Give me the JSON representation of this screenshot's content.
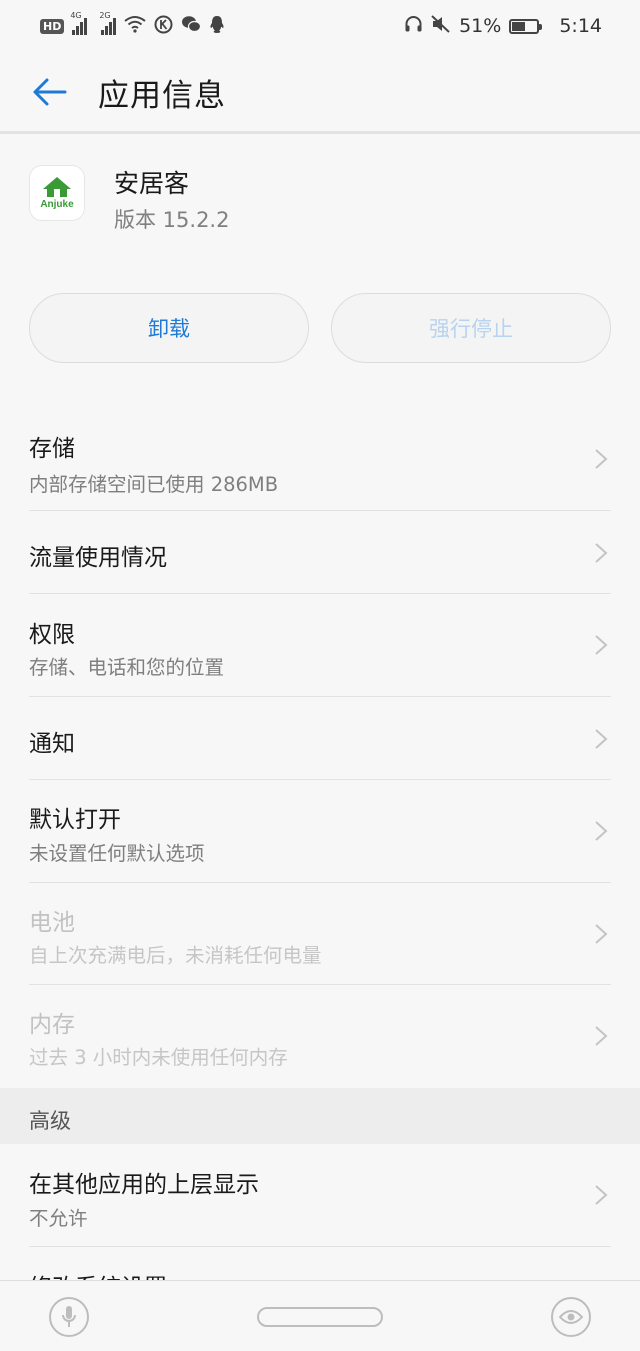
{
  "status_bar": {
    "hd": "HD",
    "sim1_tag": "4G",
    "sim2_tag": "2G",
    "battery_percent": "51%",
    "battery_level": 0.51,
    "time": "5:14"
  },
  "header": {
    "title": "应用信息"
  },
  "app": {
    "name": "安居客",
    "version": "版本 15.2.2",
    "icon_text": "Anjuke",
    "icon_color": "#3a9a35"
  },
  "actions": {
    "uninstall_label": "卸载",
    "force_stop_label": "强行停止"
  },
  "items": [
    {
      "title": "存储",
      "subtitle": "内部存储空间已使用 286MB"
    },
    {
      "title": "流量使用情况"
    },
    {
      "title": "权限",
      "subtitle": "存储、电话和您的位置"
    },
    {
      "title": "通知"
    },
    {
      "title": "默认打开",
      "subtitle": "未设置任何默认选项"
    },
    {
      "title": "电池",
      "subtitle": "自上次充满电后，未消耗任何电量"
    },
    {
      "title": "内存",
      "subtitle": "过去 3 小时内未使用任何内存"
    }
  ],
  "advanced": {
    "label": "高级",
    "items": [
      {
        "title": "在其他应用的上层显示",
        "subtitle": "不允许"
      },
      {
        "title": "修改系统设置"
      }
    ]
  },
  "colors": {
    "accent": "#1f7ad6",
    "disabled_button_text": "#b7d3ef"
  }
}
